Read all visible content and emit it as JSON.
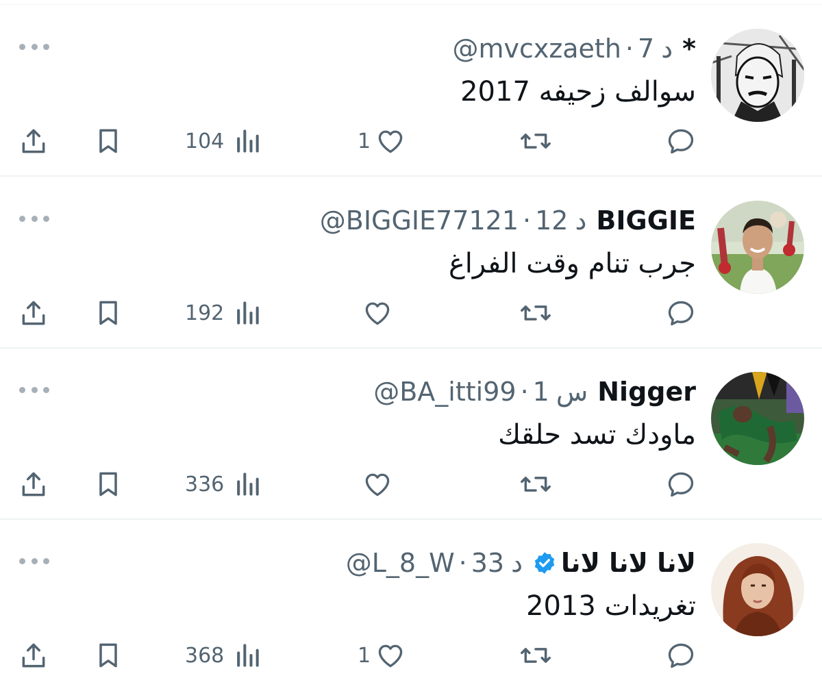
{
  "colors": {
    "text": "#0f1419",
    "secondary": "#536471",
    "divider": "#eff3f4",
    "verified": "#1d9bf0",
    "icon": "#536471"
  },
  "icons": {
    "more": "more-horizontal-icon",
    "reply": "reply-icon",
    "retweet": "retweet-icon",
    "like": "heart-icon",
    "views": "views-icon",
    "bookmark": "bookmark-icon",
    "share": "share-icon",
    "verified": "verified-badge-icon"
  },
  "tweets": [
    {
      "display_name": "*",
      "handle": "@mvcxzaeth",
      "separator": "·",
      "time_value": "7",
      "time_unit": "د",
      "verified": false,
      "text": "سوالف زحيفه 2017",
      "reply_count": "",
      "retweet_count": "",
      "like_count": "1",
      "view_count": "104"
    },
    {
      "display_name": "BIGGIE",
      "handle": "@BIGGIE77121",
      "separator": "·",
      "time_value": "12",
      "time_unit": "د",
      "verified": false,
      "text": "جرب تنام وقت الفراغ",
      "reply_count": "",
      "retweet_count": "",
      "like_count": "",
      "view_count": "192"
    },
    {
      "display_name": "Nigger",
      "handle": "@BA_itti99",
      "separator": "·",
      "time_value": "1",
      "time_unit": "س",
      "verified": false,
      "text": "ماودك تسد حلقك",
      "reply_count": "",
      "retweet_count": "",
      "like_count": "",
      "view_count": "336"
    },
    {
      "display_name": "لانا لانا لانا",
      "handle": "@L_8_W",
      "separator": "·",
      "time_value": "33",
      "time_unit": "د",
      "verified": true,
      "text": "تغريدات 2013",
      "reply_count": "",
      "retweet_count": "",
      "like_count": "1",
      "view_count": "368"
    }
  ]
}
